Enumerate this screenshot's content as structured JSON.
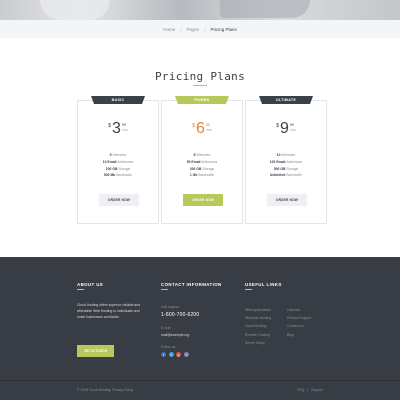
{
  "breadcrumb": {
    "home": "Home",
    "parent": "Pages",
    "current": "Pricing Plans",
    "sep": "/"
  },
  "pricing": {
    "title": "Pricing Plans",
    "accent_color": "#b8c85a",
    "plans": [
      {
        "name": "BASIC",
        "currency": "$",
        "amount": "3",
        "cents": "99",
        "period": "/mo",
        "features": [
          {
            "value": "5",
            "label": "Websites"
          },
          {
            "value": "10 Email",
            "label": "Addresses"
          },
          {
            "value": "100 GB",
            "label": "Storage"
          },
          {
            "value": "500 Mb",
            "label": "Bandwidth"
          }
        ],
        "button": "ORDER NOW"
      },
      {
        "name": "POWER",
        "currency": "$",
        "amount": "6",
        "cents": "99",
        "period": "/mo",
        "features": [
          {
            "value": "8",
            "label": "Websites"
          },
          {
            "value": "50 Email",
            "label": "Addresses"
          },
          {
            "value": "200 GB",
            "label": "Storage"
          },
          {
            "value": "1 Gb",
            "label": "Bandwidth"
          }
        ],
        "button": "ORDER NOW"
      },
      {
        "name": "ULTIMATE",
        "currency": "$",
        "amount": "9",
        "cents": "99",
        "period": "/mo",
        "features": [
          {
            "value": "10",
            "label": "Websites"
          },
          {
            "value": "100 Email",
            "label": "Addresses"
          },
          {
            "value": "500 GB",
            "label": "Storage"
          },
          {
            "value": "Unlimited",
            "label": "Bandwidth"
          }
        ],
        "button": "ORDER NOW"
      }
    ]
  },
  "footer": {
    "about": {
      "title": "ABOUT US",
      "text": "Cloud Hosting offers superior, reliable and affordable Web Hosting to individuals and small businesses worldwide.",
      "button": "GET IN TOUCH"
    },
    "contact": {
      "title": "CONTACT INFORMATION",
      "phone_label": "Call support",
      "phone": "1-800-700-6200",
      "email_label": "E-mail",
      "email": "mail@example.org",
      "social_label": "Follow us",
      "socials": [
        {
          "name": "facebook-icon",
          "glyph": "f",
          "color": "#4a6fb5"
        },
        {
          "name": "twitter-icon",
          "glyph": "t",
          "color": "#3aa6e0"
        },
        {
          "name": "google-plus-icon",
          "glyph": "g",
          "color": "#d9534f"
        },
        {
          "name": "instagram-icon",
          "glyph": "i",
          "color": "#7a8aa6"
        }
      ]
    },
    "links": {
      "title": "USEFUL LINKS",
      "col1": [
        "Web Applications",
        "Windows Hosting",
        "Cloud Hosting",
        "Reseller Hosting",
        "Server Setup"
      ],
      "col2": [
        "Licenses",
        "Product Support",
        "Contact Us",
        "Blog"
      ]
    },
    "copyright": "© 2019 Cloud Hosting. Privacy Policy",
    "bottom_links": [
      "FAQ",
      "Support"
    ]
  }
}
